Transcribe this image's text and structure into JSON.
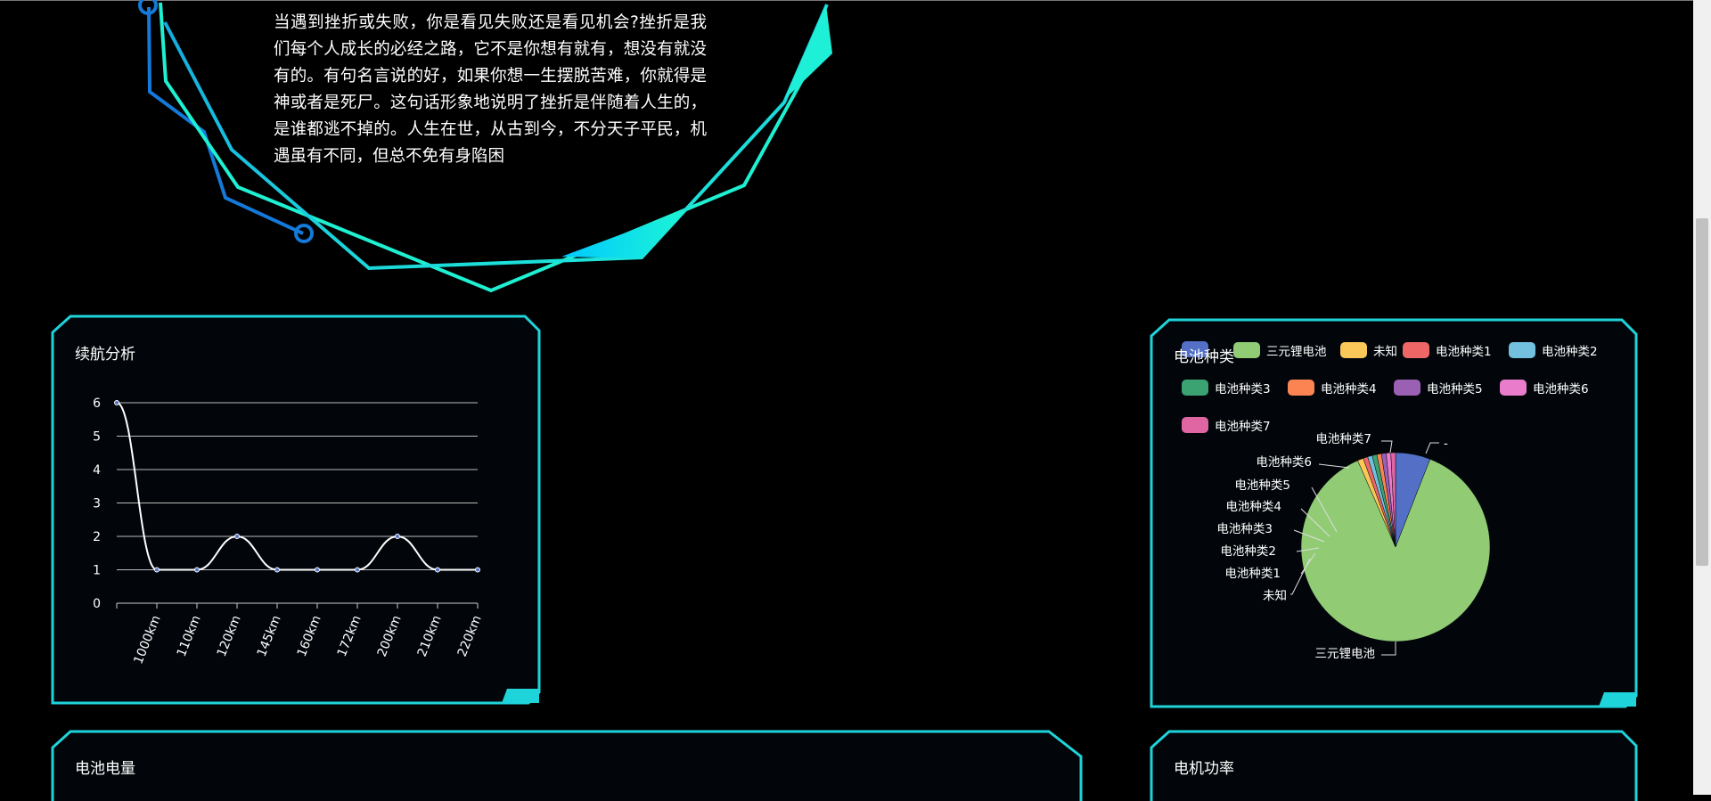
{
  "intro": {
    "text": "当遇到挫折或失败，你是看见失败还是看见机会?挫折是我们每个人成长的必经之路，它不是你想有就有，想没有就没有的。有句名言说的好，如果你想一生摆脱苦难，你就得是神或者是死尸。这句话形象地说明了挫折是伴随着人生的，是谁都逃不掉的。人生在世，从古到今，不分天子平民，机遇虽有不同，但总不免有身陷困"
  },
  "panels": {
    "range": {
      "title": "续航分析"
    },
    "battery_type": {
      "title": "电池种类"
    },
    "battery_level": {
      "title": "电池电量"
    },
    "motor_power": {
      "title": "电机功率"
    }
  },
  "colors": {
    "frame": "#1fd3db",
    "panel_fill": "#02060a",
    "line": "#ffffff",
    "point": "#5470c6"
  },
  "chart_data": [
    {
      "type": "line",
      "title": "续航分析",
      "categories": [
        "1000km",
        "110km",
        "120km",
        "145km",
        "160km",
        "172km",
        "200km",
        "210km",
        "220km"
      ],
      "x": [
        "",
        "1000km",
        "110km",
        "120km",
        "145km",
        "160km",
        "172km",
        "200km",
        "210km",
        "220km"
      ],
      "series": [
        {
          "values": [
            6,
            1,
            1,
            2,
            1,
            1,
            1,
            2,
            1,
            1
          ]
        }
      ],
      "y_ticks": [
        0,
        1,
        2,
        3,
        4,
        5,
        6
      ],
      "ylim": [
        0,
        6
      ],
      "smooth": true,
      "grid": true
    },
    {
      "type": "pie",
      "title": "电池种类",
      "legend_position": "top",
      "slices": [
        {
          "name": "-",
          "value": 6,
          "color": "#5470c6"
        },
        {
          "name": "三元锂电池",
          "value": 88,
          "color": "#91cc75"
        },
        {
          "name": "未知",
          "value": 1,
          "color": "#fac858"
        },
        {
          "name": "电池种类1",
          "value": 0.8,
          "color": "#ee6666"
        },
        {
          "name": "电池种类2",
          "value": 0.8,
          "color": "#73c0de"
        },
        {
          "name": "电池种类3",
          "value": 0.8,
          "color": "#3ba272"
        },
        {
          "name": "电池种类4",
          "value": 0.8,
          "color": "#fc8452"
        },
        {
          "name": "电池种类5",
          "value": 0.8,
          "color": "#9a60b4"
        },
        {
          "name": "电池种类6",
          "value": 0.8,
          "color": "#ea7ccc"
        },
        {
          "name": "电池种类7",
          "value": 0.8,
          "color": "#e066a3"
        }
      ],
      "legend": [
        "-",
        "三元锂电池",
        "未知",
        "电池种类1",
        "电池种类2",
        "电池种类3",
        "电池种类4",
        "电池种类5",
        "电池种类6",
        "电池种类7"
      ]
    }
  ]
}
